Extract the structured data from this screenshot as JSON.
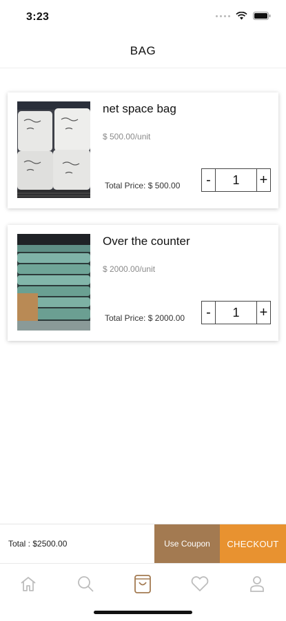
{
  "status": {
    "time": "3:23"
  },
  "header": {
    "title": "BAG"
  },
  "items": [
    {
      "name": "net space bag",
      "unit_price": "$ 500.00/unit",
      "total": "Total Price: $ 500.00",
      "qty": "1",
      "minus": "-",
      "plus": "+",
      "image": "white-sacks-photo"
    },
    {
      "name": "Over the counter",
      "unit_price": "$ 2000.00/unit",
      "total": "Total Price: $ 2000.00",
      "qty": "1",
      "minus": "-",
      "plus": "+",
      "image": "green-bags-photo"
    }
  ],
  "summary": {
    "total": "Total : $2500.00",
    "coupon_label": "Use Coupon",
    "checkout_label": "CHECKOUT"
  },
  "tabs": [
    {
      "icon": "home-icon",
      "active": false
    },
    {
      "icon": "search-icon",
      "active": false
    },
    {
      "icon": "bag-icon",
      "active": true
    },
    {
      "icon": "heart-icon",
      "active": false
    },
    {
      "icon": "profile-icon",
      "active": false
    }
  ],
  "colors": {
    "coupon": "#a37a51",
    "checkout": "#e89230",
    "active_tab": "#a37a51",
    "inactive_tab": "#bdbdbd"
  }
}
